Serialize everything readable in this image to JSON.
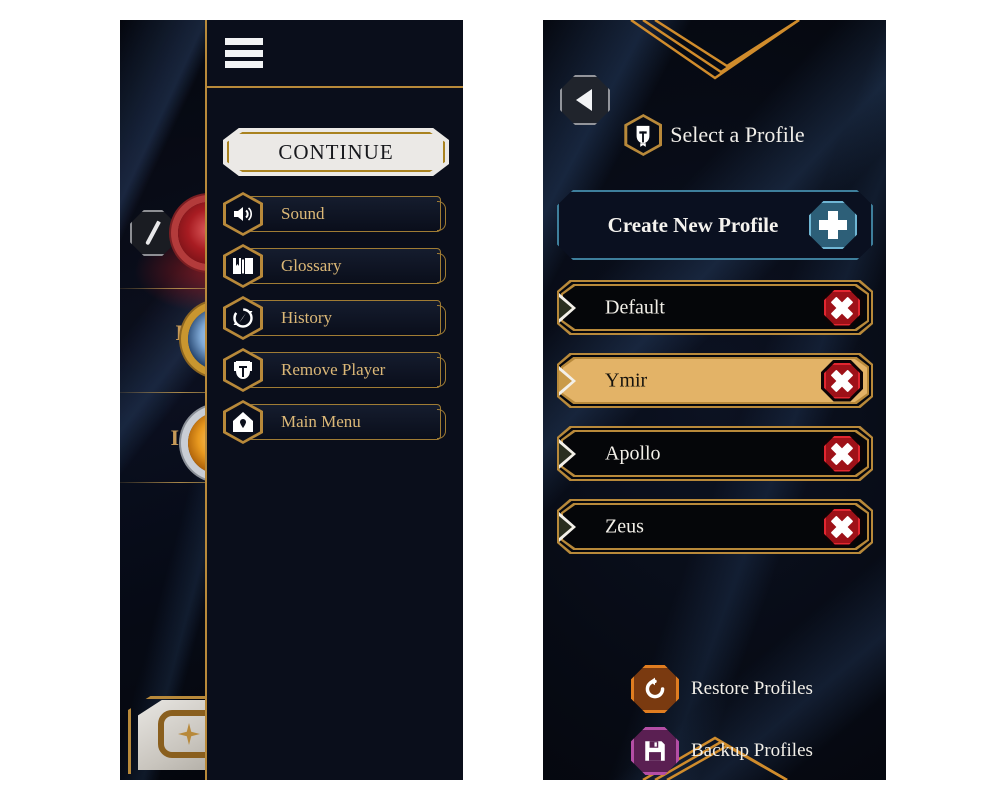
{
  "left_panel": {
    "name": "pause-menu-overlay",
    "hamburger_icon": "hamburger-menu-icon",
    "continue_label": "CONTINUE",
    "menu_items": [
      {
        "label": "Sound",
        "icon": "speaker-icon"
      },
      {
        "label": "Glossary",
        "icon": "open-book-icon"
      },
      {
        "label": "History",
        "icon": "compass-refresh-icon"
      },
      {
        "label": "Remove Player",
        "icon": "helmet-icon"
      },
      {
        "label": "Main Menu",
        "icon": "house-icon"
      }
    ],
    "background_rows": [
      {
        "numeral": ""
      },
      {
        "numeral": "I"
      },
      {
        "numeral": "II"
      },
      {
        "numeral": ""
      }
    ],
    "quill_icon": "quill-icon"
  },
  "right_panel": {
    "back_icon": "back-arrow-icon",
    "title": "Select a Profile",
    "title_icon": "spartan-helmet-icon",
    "create_label": "Create New Profile",
    "create_icon": "plus-icon",
    "profiles": [
      {
        "name": "Default",
        "selected": false,
        "delete_icon": "delete-x-icon"
      },
      {
        "name": "Ymir",
        "selected": true,
        "delete_icon": "delete-x-icon"
      },
      {
        "name": "Apollo",
        "selected": false,
        "delete_icon": "delete-x-icon"
      },
      {
        "name": "Zeus",
        "selected": false,
        "delete_icon": "delete-x-icon"
      }
    ],
    "actions": [
      {
        "label": "Restore Profiles",
        "icon": "restore-undo-icon",
        "style": "restore"
      },
      {
        "label": "Backup Profiles",
        "icon": "floppy-save-icon",
        "style": "backup"
      }
    ]
  },
  "colors": {
    "gold": "#b8893a",
    "gold_text": "#dcb877",
    "panel_bg": "#0a0e1b",
    "selected_row": "#e3b367",
    "teal_border": "#3e7f9c",
    "delete_red": "#9e1118",
    "restore_orange": "#e07d20",
    "backup_purple": "#b44ea5"
  }
}
